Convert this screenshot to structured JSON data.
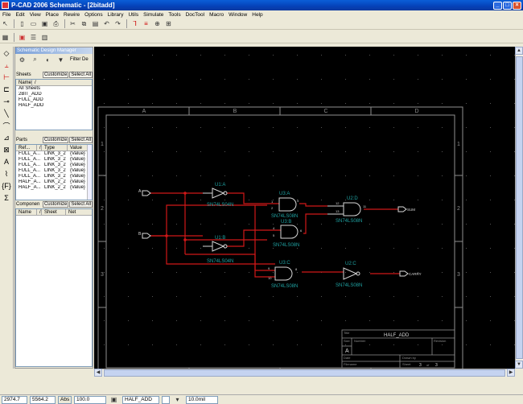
{
  "window": {
    "title": "P-CAD 2006 Schematic - [2bitadd]",
    "min": "_",
    "max": "□",
    "close": "×"
  },
  "menu": [
    "File",
    "Edit",
    "View",
    "Place",
    "Rewire",
    "Options",
    "Library",
    "Utils",
    "Simulate",
    "Tools",
    "DocTool",
    "Macro",
    "Window",
    "Help"
  ],
  "sdm": {
    "title": "Schematic Design Manager",
    "filter_label": "Filter De",
    "sheets": {
      "label": "Sheets",
      "customize": "Customize",
      "select_all": "Select All",
      "columns": [
        "Name",
        "/"
      ],
      "items": [
        "All Sheets",
        "2BIT_ADD",
        "FULL_ADD",
        "HALF_ADD"
      ]
    },
    "parts": {
      "label": "Parts",
      "customize": "Customize",
      "select_all": "Select All",
      "columns": [
        "Ref...",
        "/",
        "Type",
        "Value"
      ],
      "rows": [
        [
          "FULL_A...",
          "LINK_3_2",
          "{Value}"
        ],
        [
          "FULL_A...",
          "LINK_3_2",
          "{Value}"
        ],
        [
          "FULL_A...",
          "LINK_3_2",
          "{Value}"
        ],
        [
          "FULL_A...",
          "LINK_3_2",
          "{Value}"
        ],
        [
          "FULL_A...",
          "LINK_3_2",
          "{Value}"
        ],
        [
          "HALF_A...",
          "LINK_2_2",
          "{Value}"
        ],
        [
          "HALF_A...",
          "LINK_2_2",
          "{Value}"
        ]
      ]
    },
    "components": {
      "label": "Componen",
      "customize": "Customize",
      "select_all": "Select All",
      "columns": [
        "Name",
        "/",
        "Sheet",
        "Net"
      ]
    }
  },
  "schematic": {
    "col_labels": [
      "A",
      "B",
      "C",
      "D"
    ],
    "row_labels": [
      "1",
      "2",
      "3"
    ],
    "parts": [
      {
        "ref": "U1:A",
        "type": "SN74LS04N"
      },
      {
        "ref": "U1:B",
        "type": "SN74LS04N"
      },
      {
        "ref": "U3:A",
        "type": "SN74LS08N"
      },
      {
        "ref": "U3:B",
        "type": "SN74LS08N"
      },
      {
        "ref": "U3:C",
        "type": "SN74LS08N"
      },
      {
        "ref": "U2:D",
        "type": "SN74LS08N"
      },
      {
        "ref": "U2:C",
        "type": "SN74LS08N"
      }
    ],
    "pins": {
      "p1": "1",
      "p2": "2",
      "p3": "3",
      "p4": "4",
      "p5": "5",
      "p6": "6",
      "p8": "8",
      "p9": "9",
      "p10": "10",
      "p12": "12",
      "p13": "13",
      "p11": "11"
    },
    "ports": {
      "in_a": "A",
      "in_b": "B",
      "sum": "SUM",
      "carry": "CARRY"
    },
    "title_block": {
      "title_label": "Title",
      "title": "HALF_ADD",
      "size_label": "Size",
      "size": "A",
      "number_label": "Number",
      "revision_label": "Revision",
      "date_label": "Date",
      "drawn_label": "Drawn by",
      "filename_label": "Filename",
      "sheet_label": "Sheet",
      "sheet_num": "3",
      "of_label": "of",
      "sheet_total": "3"
    }
  },
  "status": {
    "x": "2974.7",
    "y": "5564.2",
    "abs": "Abs",
    "zoom": "100.0",
    "sheet": "HALF_ADD",
    "grid": "10.0mil"
  },
  "colors": {
    "canvas": "#000000",
    "border": "#8f8f8f",
    "wire": "#d01818",
    "part": "#d8d8d8",
    "label": "#1fa3a3"
  }
}
